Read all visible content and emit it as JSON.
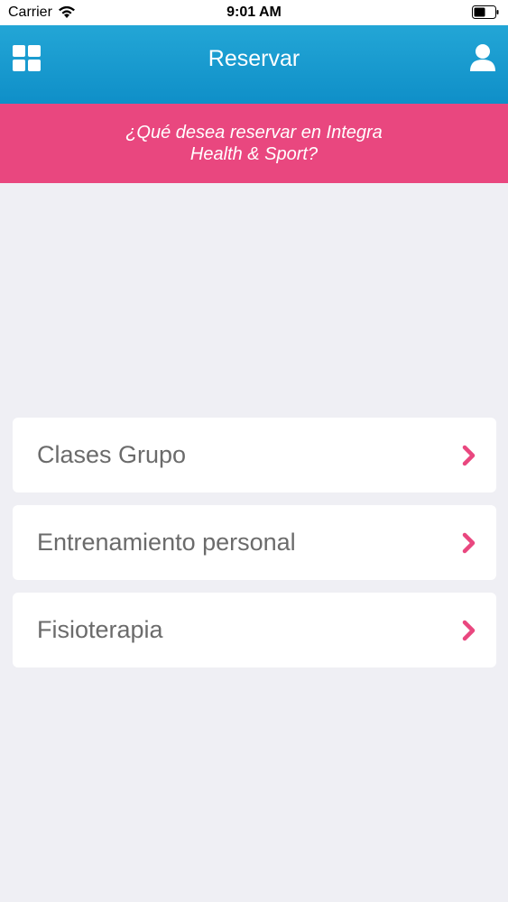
{
  "status_bar": {
    "carrier": "Carrier",
    "time": "9:01 AM"
  },
  "header": {
    "title": "Reservar",
    "menu_icon": "grid-menu-icon",
    "user_icon": "user-icon",
    "color": "#1a9bd1"
  },
  "banner": {
    "text": "¿Qué desea reservar en Integra Health & Sport?",
    "color": "#e9477f"
  },
  "options": [
    {
      "label": "Clases Grupo",
      "icon": "chevron-right-icon"
    },
    {
      "label": "Entrenamiento personal",
      "icon": "chevron-right-icon"
    },
    {
      "label": "Fisioterapia",
      "icon": "chevron-right-icon"
    }
  ],
  "accent_color": "#e9477f"
}
